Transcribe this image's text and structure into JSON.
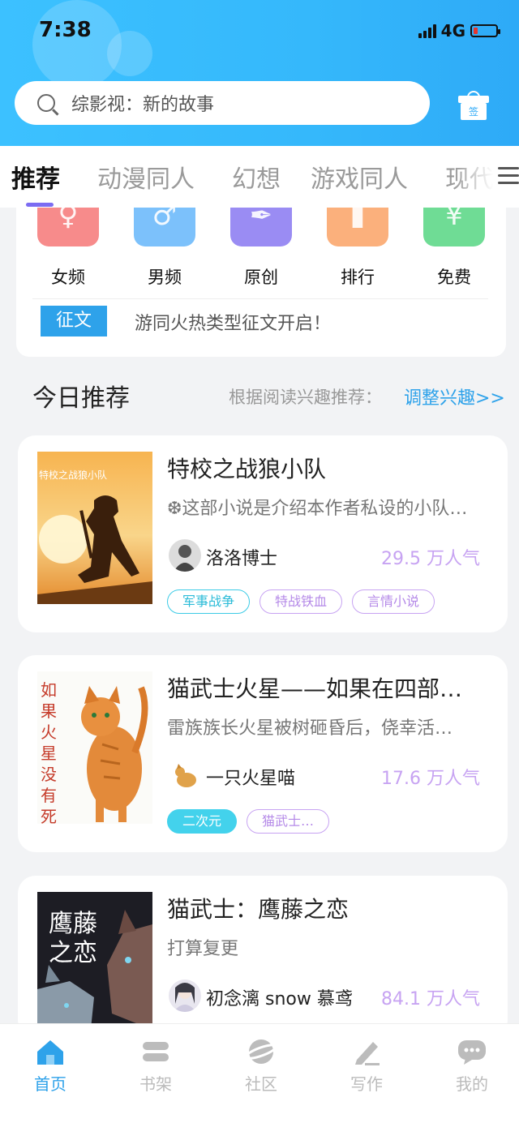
{
  "status": {
    "time": "7:38",
    "network": "4G"
  },
  "search": {
    "placeholder": "综影视：新的故事"
  },
  "gift": {
    "label": "签"
  },
  "tabs": [
    {
      "label": "推荐",
      "active": true
    },
    {
      "label": "动漫同人"
    },
    {
      "label": "幻想"
    },
    {
      "label": "游戏同人"
    },
    {
      "label": "现代"
    }
  ],
  "categories": [
    {
      "label": "女频",
      "color": "#f78b8b"
    },
    {
      "label": "男频",
      "color": "#7cc1fb"
    },
    {
      "label": "原创",
      "color": "#9a8cf3"
    },
    {
      "label": "排行",
      "color": "#fbb07c"
    },
    {
      "label": "免费",
      "color": "#6fdc95"
    }
  ],
  "notice": {
    "badge": "征文",
    "text": "游同火热类型征文开启！"
  },
  "recommend": {
    "title": "今日推荐",
    "hint": "根据阅读兴趣推荐：",
    "link": "调整兴趣>>"
  },
  "books": [
    {
      "title": "特校之战狼小队",
      "desc": "❆这部小说是介绍本作者私设的小队…",
      "author": "洛洛博士",
      "popularity": "29.5 万人气",
      "cover_text": "特校之战狼小队",
      "tags": [
        {
          "label": "军事战争",
          "style": "cyan"
        },
        {
          "label": "特战铁血",
          "style": "purple"
        },
        {
          "label": "言情小说",
          "style": "purple"
        }
      ]
    },
    {
      "title": "猫武士火星——如果在四部…",
      "desc": "雷族族长火星被树砸昏后，侥幸活…",
      "author": "一只火星喵",
      "popularity": "17.6 万人气",
      "cover_text": "如果火星没有死",
      "tags": [
        {
          "label": "二次元",
          "style": "filled"
        },
        {
          "label": "猫武士…",
          "style": "purple"
        }
      ]
    },
    {
      "title": "猫武士：鹰藤之恋",
      "desc": "打算复更",
      "author": "初念漓 snow 慕鸢",
      "popularity": "84.1 万人气",
      "cover_text": "鹰藤之恋",
      "tags": []
    }
  ],
  "nav": [
    {
      "label": "首页",
      "icon": "home-icon",
      "active": true
    },
    {
      "label": "书架",
      "icon": "bookshelf-icon"
    },
    {
      "label": "社区",
      "icon": "community-icon"
    },
    {
      "label": "写作",
      "icon": "write-icon"
    },
    {
      "label": "我的",
      "icon": "profile-icon"
    }
  ],
  "colors": {
    "accent": "#2ea2ea",
    "tab_indicator": "#7c6cf2",
    "popularity": "#c7a3f2"
  }
}
